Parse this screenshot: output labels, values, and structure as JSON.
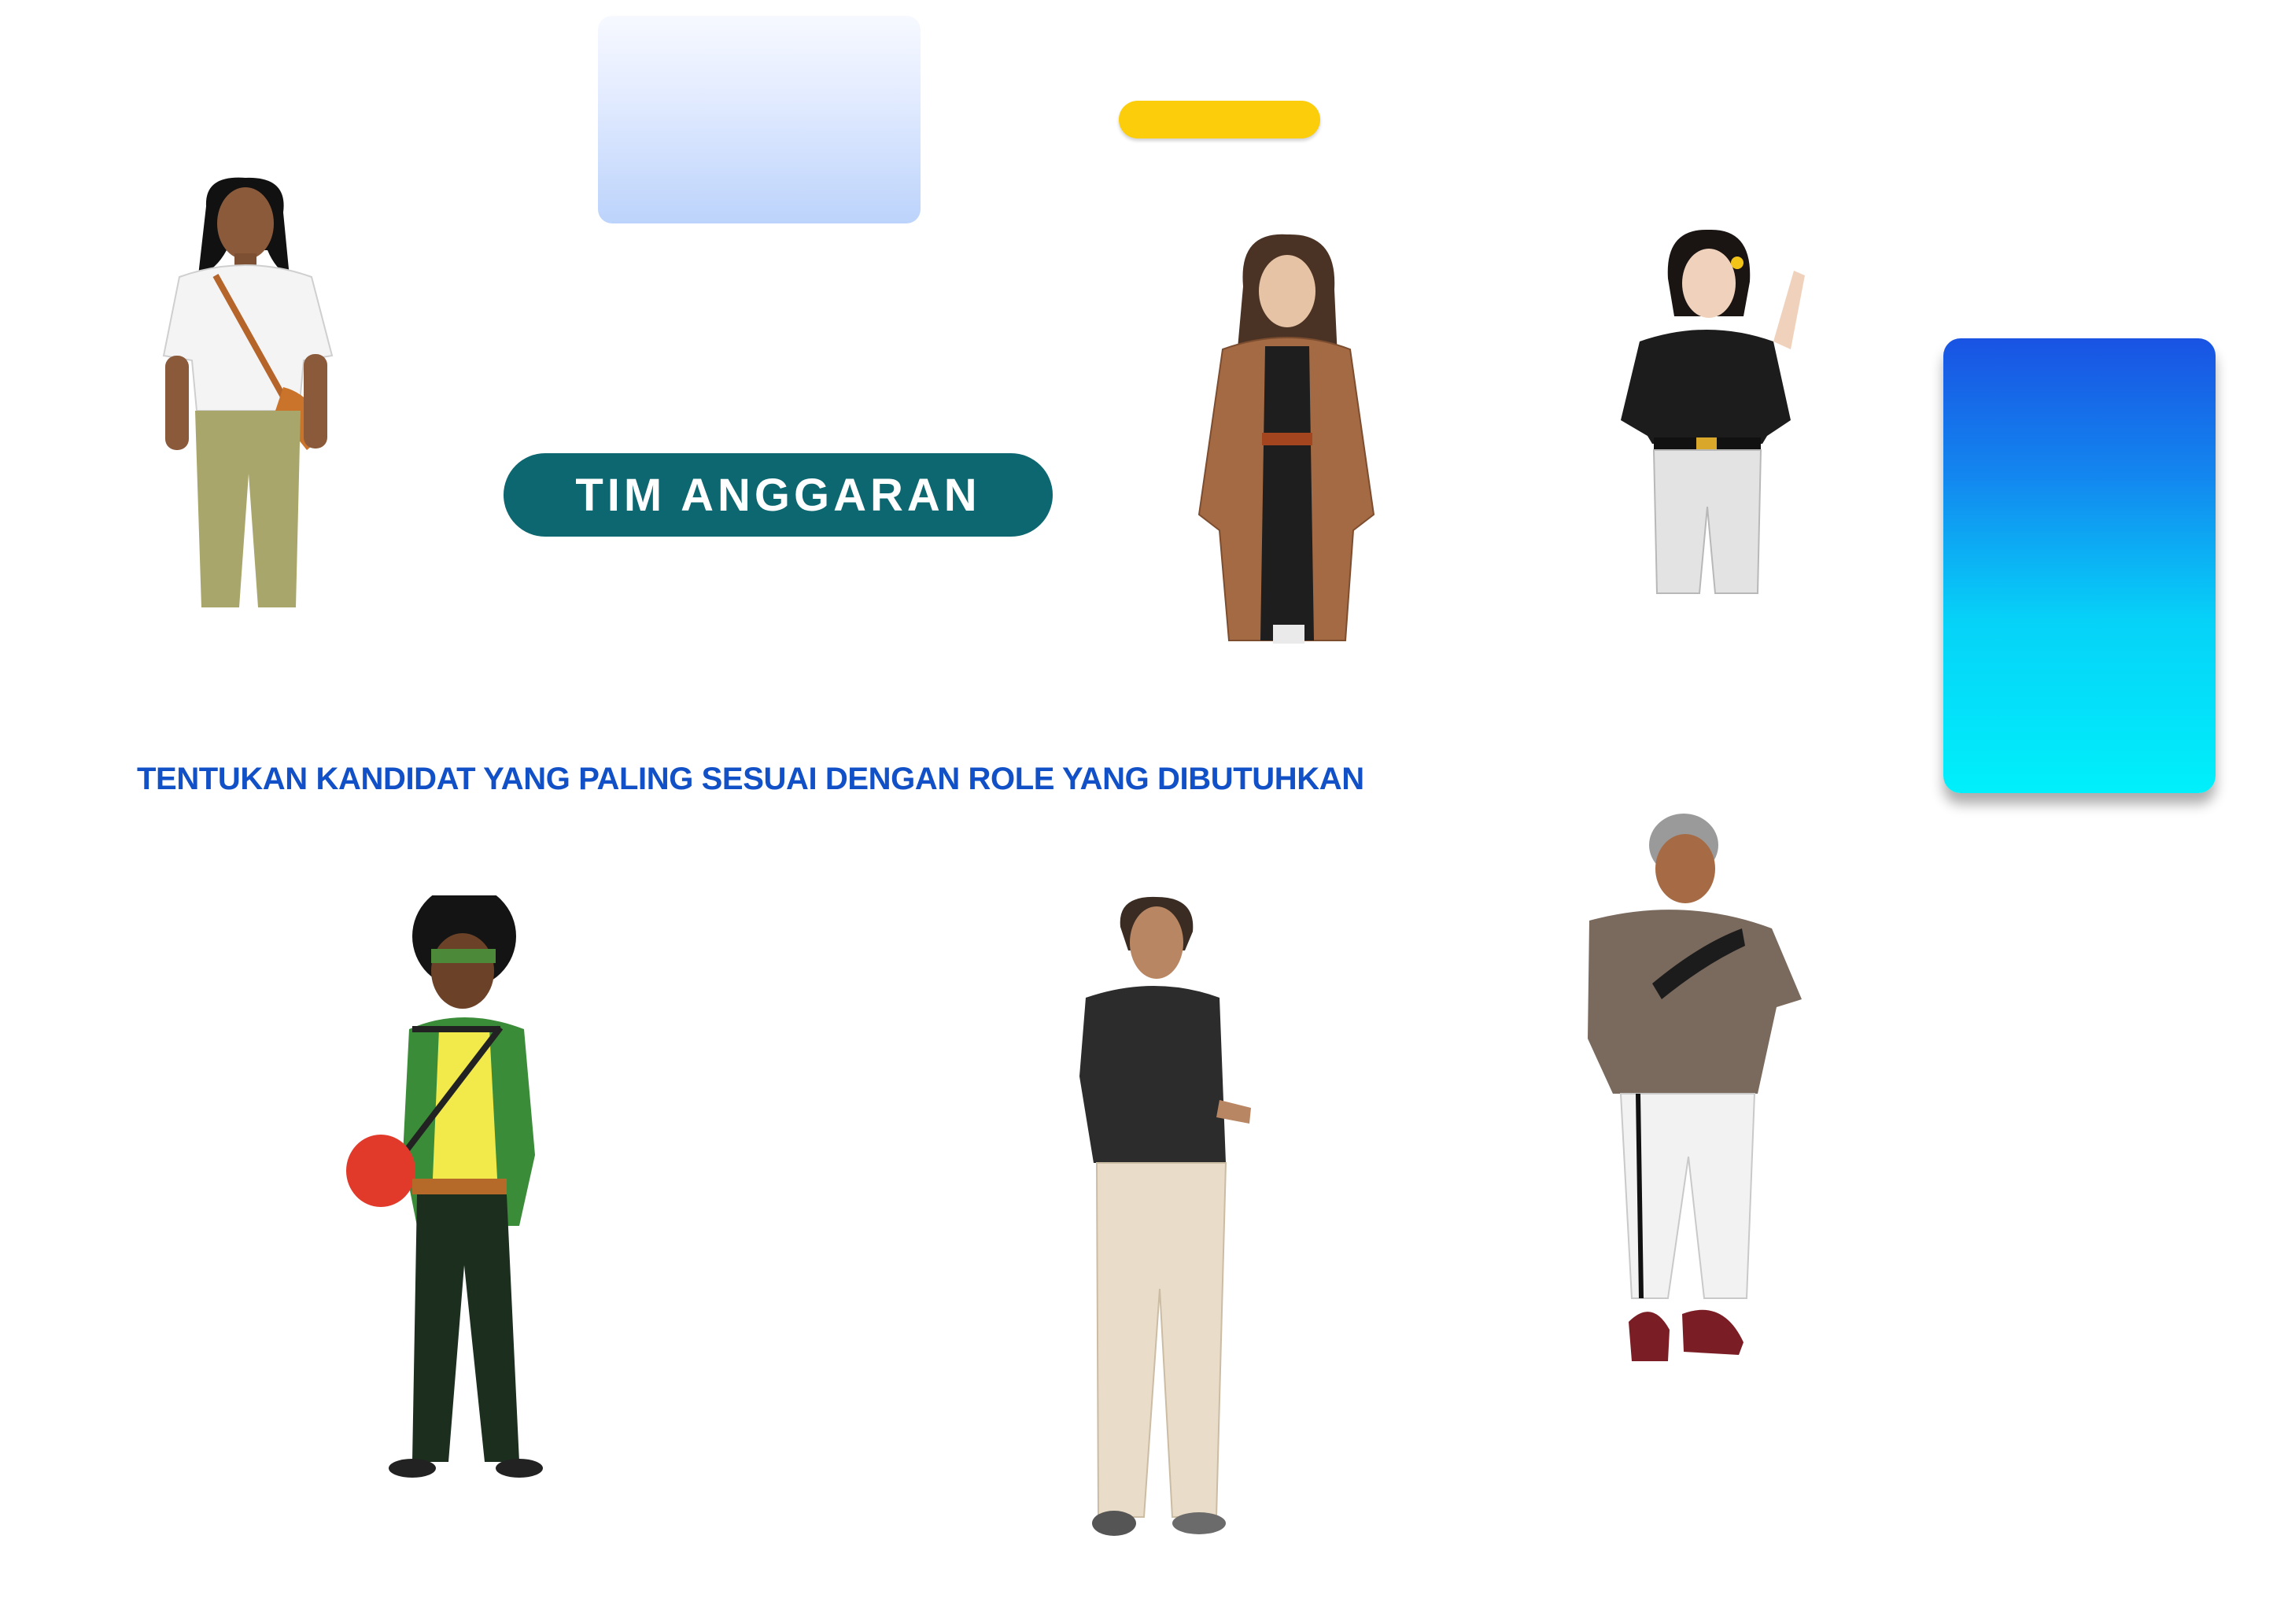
{
  "header": {
    "team_label": "TIM ANGGARAN"
  },
  "instruction": {
    "text": "TENTUKAN KANDIDAT YANG PALING SESUAI DENGAN ROLE YANG DIBUTUHKAN"
  },
  "colors": {
    "team_pill": "#0c6770",
    "instruction_text": "#1150c6",
    "yellow_bar": "#fccd0a",
    "blue_panel_top": "#1953e3",
    "blue_panel_bottom": "#00f0fb",
    "light_panel_bottom": "#bcd3fb"
  },
  "candidates": [
    {
      "id": "long-hair-white-shirt",
      "description_icon": "candidate-figure"
    },
    {
      "id": "brown-coat-woman",
      "description_icon": "candidate-figure"
    },
    {
      "id": "black-blouse-woman",
      "description_icon": "candidate-figure"
    },
    {
      "id": "afro-green-jacket",
      "description_icon": "candidate-figure"
    },
    {
      "id": "dark-shirt-man",
      "description_icon": "candidate-figure"
    },
    {
      "id": "grey-sweater-man",
      "description_icon": "candidate-figure"
    }
  ]
}
